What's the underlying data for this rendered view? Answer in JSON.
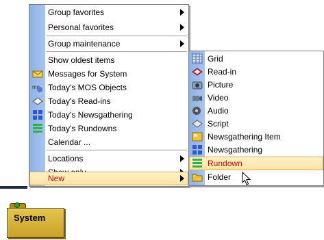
{
  "main_menu": {
    "items": [
      {
        "label": "Group favorites",
        "submenu": true
      },
      {
        "label": "Personal favorites",
        "submenu": true
      },
      {
        "label": "Group maintenance",
        "submenu": true
      },
      {
        "label": "Show oldest items",
        "submenu": false
      },
      {
        "label": "Messages for System",
        "icon": "envelope-icon"
      },
      {
        "label": "Today's MOS Objects",
        "icon": "mos-objects-icon"
      },
      {
        "label": "Today's Read-ins",
        "icon": "read-in-icon"
      },
      {
        "label": "Today's Newsgathering",
        "icon": "newsgathering-icon"
      },
      {
        "label": "Today's Rundowns",
        "icon": "rundown-icon"
      },
      {
        "label": "Calendar ...",
        "submenu": false
      },
      {
        "label": "Locations",
        "submenu": true
      },
      {
        "label": "Show only",
        "submenu": true
      },
      {
        "label": "New",
        "submenu": true,
        "active": true
      }
    ]
  },
  "new_submenu": {
    "items": [
      {
        "label": "Grid",
        "icon": "grid-icon"
      },
      {
        "label": "Read-in",
        "icon": "read-in-icon"
      },
      {
        "label": "Picture",
        "icon": "camera-icon"
      },
      {
        "label": "Video",
        "icon": "video-camera-icon"
      },
      {
        "label": "Audio",
        "icon": "speaker-icon"
      },
      {
        "label": "Script",
        "icon": "script-icon"
      },
      {
        "label": "Newsgathering Item",
        "icon": "newsgathering-item-icon"
      },
      {
        "label": "Newsgathering",
        "icon": "newsgathering-icon"
      },
      {
        "label": "Rundown",
        "icon": "rundown-icon",
        "highlighted": true
      },
      {
        "label": "Folder",
        "icon": "folder-icon"
      }
    ]
  },
  "desktop": {
    "system_folder_label": "System"
  },
  "colors": {
    "gutter": "#a9c4ee",
    "highlight_bg": "#ffe3a0",
    "active_text": "#d40000",
    "folder": "#c9a227"
  }
}
